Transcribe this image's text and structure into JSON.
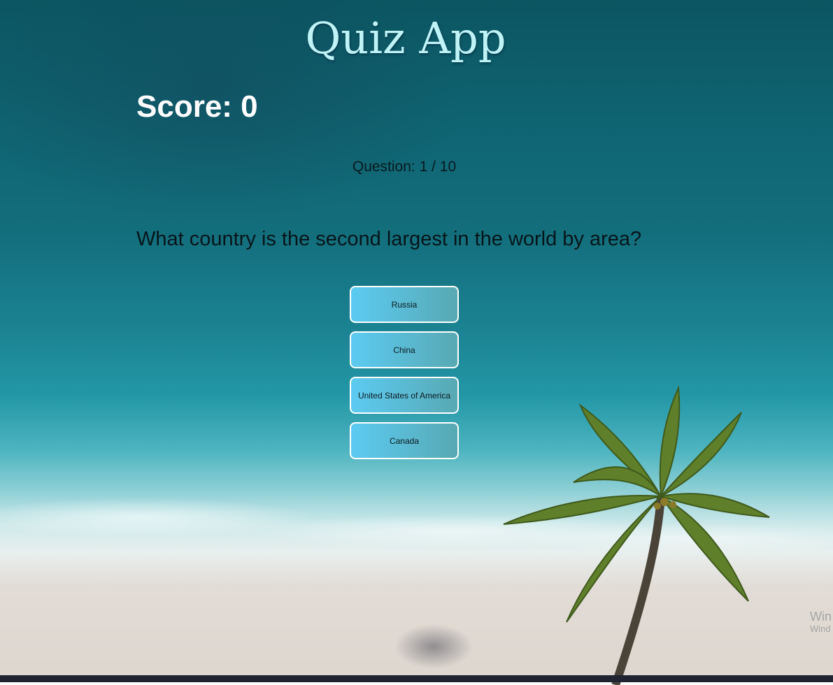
{
  "app": {
    "title": "Quiz App"
  },
  "score": {
    "text": "Score: 0"
  },
  "progress": {
    "text": "Question: 1 / 10"
  },
  "question": {
    "text": "What country is the second largest in the world by area?"
  },
  "answers": [
    {
      "label": "Russia"
    },
    {
      "label": "China"
    },
    {
      "label": "United States of America"
    },
    {
      "label": "Canada"
    }
  ],
  "watermark": {
    "line1": "Win",
    "line2": "Wind"
  },
  "colors": {
    "title": "#bff3f6",
    "answer_gradient_start": "#5ccbf2",
    "answer_gradient_end": "#58a9b3"
  }
}
